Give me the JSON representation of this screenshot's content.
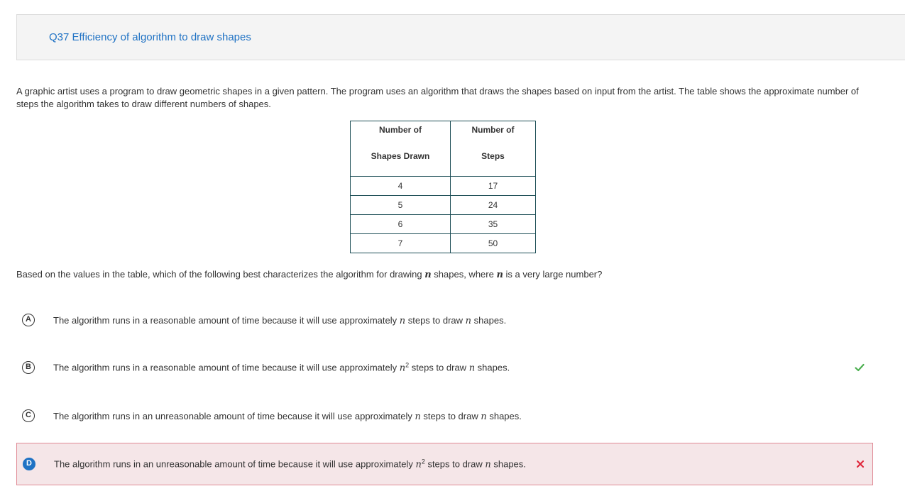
{
  "header": {
    "title": "Q37 Efficiency of algorithm to draw shapes"
  },
  "prompt": {
    "text": "A graphic artist uses a program to draw geometric shapes in a given pattern. The program uses an algorithm that draws the shapes based on input from the artist. The table shows the approximate number of steps the algorithm takes to draw different numbers of shapes."
  },
  "table": {
    "headers": [
      {
        "line1": "Number of",
        "line2": "Shapes Drawn"
      },
      {
        "line1": "Number of",
        "line2": "Steps"
      }
    ],
    "rows": [
      [
        "4",
        "17"
      ],
      [
        "5",
        "24"
      ],
      [
        "6",
        "35"
      ],
      [
        "7",
        "50"
      ]
    ]
  },
  "question": {
    "part1": "Based on the values in the table, which of the following best characterizes the algorithm for drawing ",
    "var1": "n",
    "part2": " shapes, where ",
    "var2": "n",
    "part3": " is a very large number?"
  },
  "options": [
    {
      "letter": "A",
      "pre": "The algorithm runs in a reasonable amount of time because it will use approximately ",
      "steps_var": "n",
      "sup": "",
      "mid": " steps to draw ",
      "var": "n",
      "post": " shapes."
    },
    {
      "letter": "B",
      "pre": "The algorithm runs in a reasonable amount of time because it will use approximately ",
      "steps_var": "n",
      "sup": "2",
      "mid": " steps to draw ",
      "var": "n",
      "post": " shapes."
    },
    {
      "letter": "C",
      "pre": "The algorithm runs in an unreasonable amount of time because it will use approximately ",
      "steps_var": "n",
      "sup": "",
      "mid": " steps to draw ",
      "var": "n",
      "post": " shapes."
    },
    {
      "letter": "D",
      "pre": "The algorithm runs in an unreasonable amount of time because it will use approximately ",
      "steps_var": "n",
      "sup": "2",
      "mid": " steps to draw ",
      "var": "n",
      "post": " shapes."
    }
  ],
  "marks": {
    "correct_icon": "check-icon",
    "incorrect_icon": "x-icon",
    "correct_color": "#4caf50",
    "incorrect_color": "#e0293d"
  },
  "colors": {
    "accent": "#1f72c4",
    "selected_bg": "#f5e6e8",
    "selected_border": "#e08a95"
  }
}
